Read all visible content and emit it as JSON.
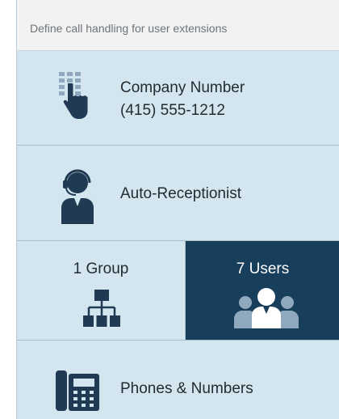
{
  "header": {
    "text": "Define call handling for user extensions"
  },
  "company": {
    "title": "Company Number",
    "number": "(415) 555-1212",
    "icon": "keypad-hand-icon"
  },
  "receptionist": {
    "title": "Auto-Receptionist",
    "icon": "headset-person-icon"
  },
  "groups": {
    "label": "1 Group",
    "icon": "org-chart-icon"
  },
  "users": {
    "label": "7 Users",
    "icon": "users-group-icon"
  },
  "phones": {
    "title": "Phones & Numbers",
    "icon": "desk-phone-icon"
  },
  "colors": {
    "panel": "#d3e6ef",
    "selected": "#173e5a",
    "icon": "#1f3a52"
  }
}
